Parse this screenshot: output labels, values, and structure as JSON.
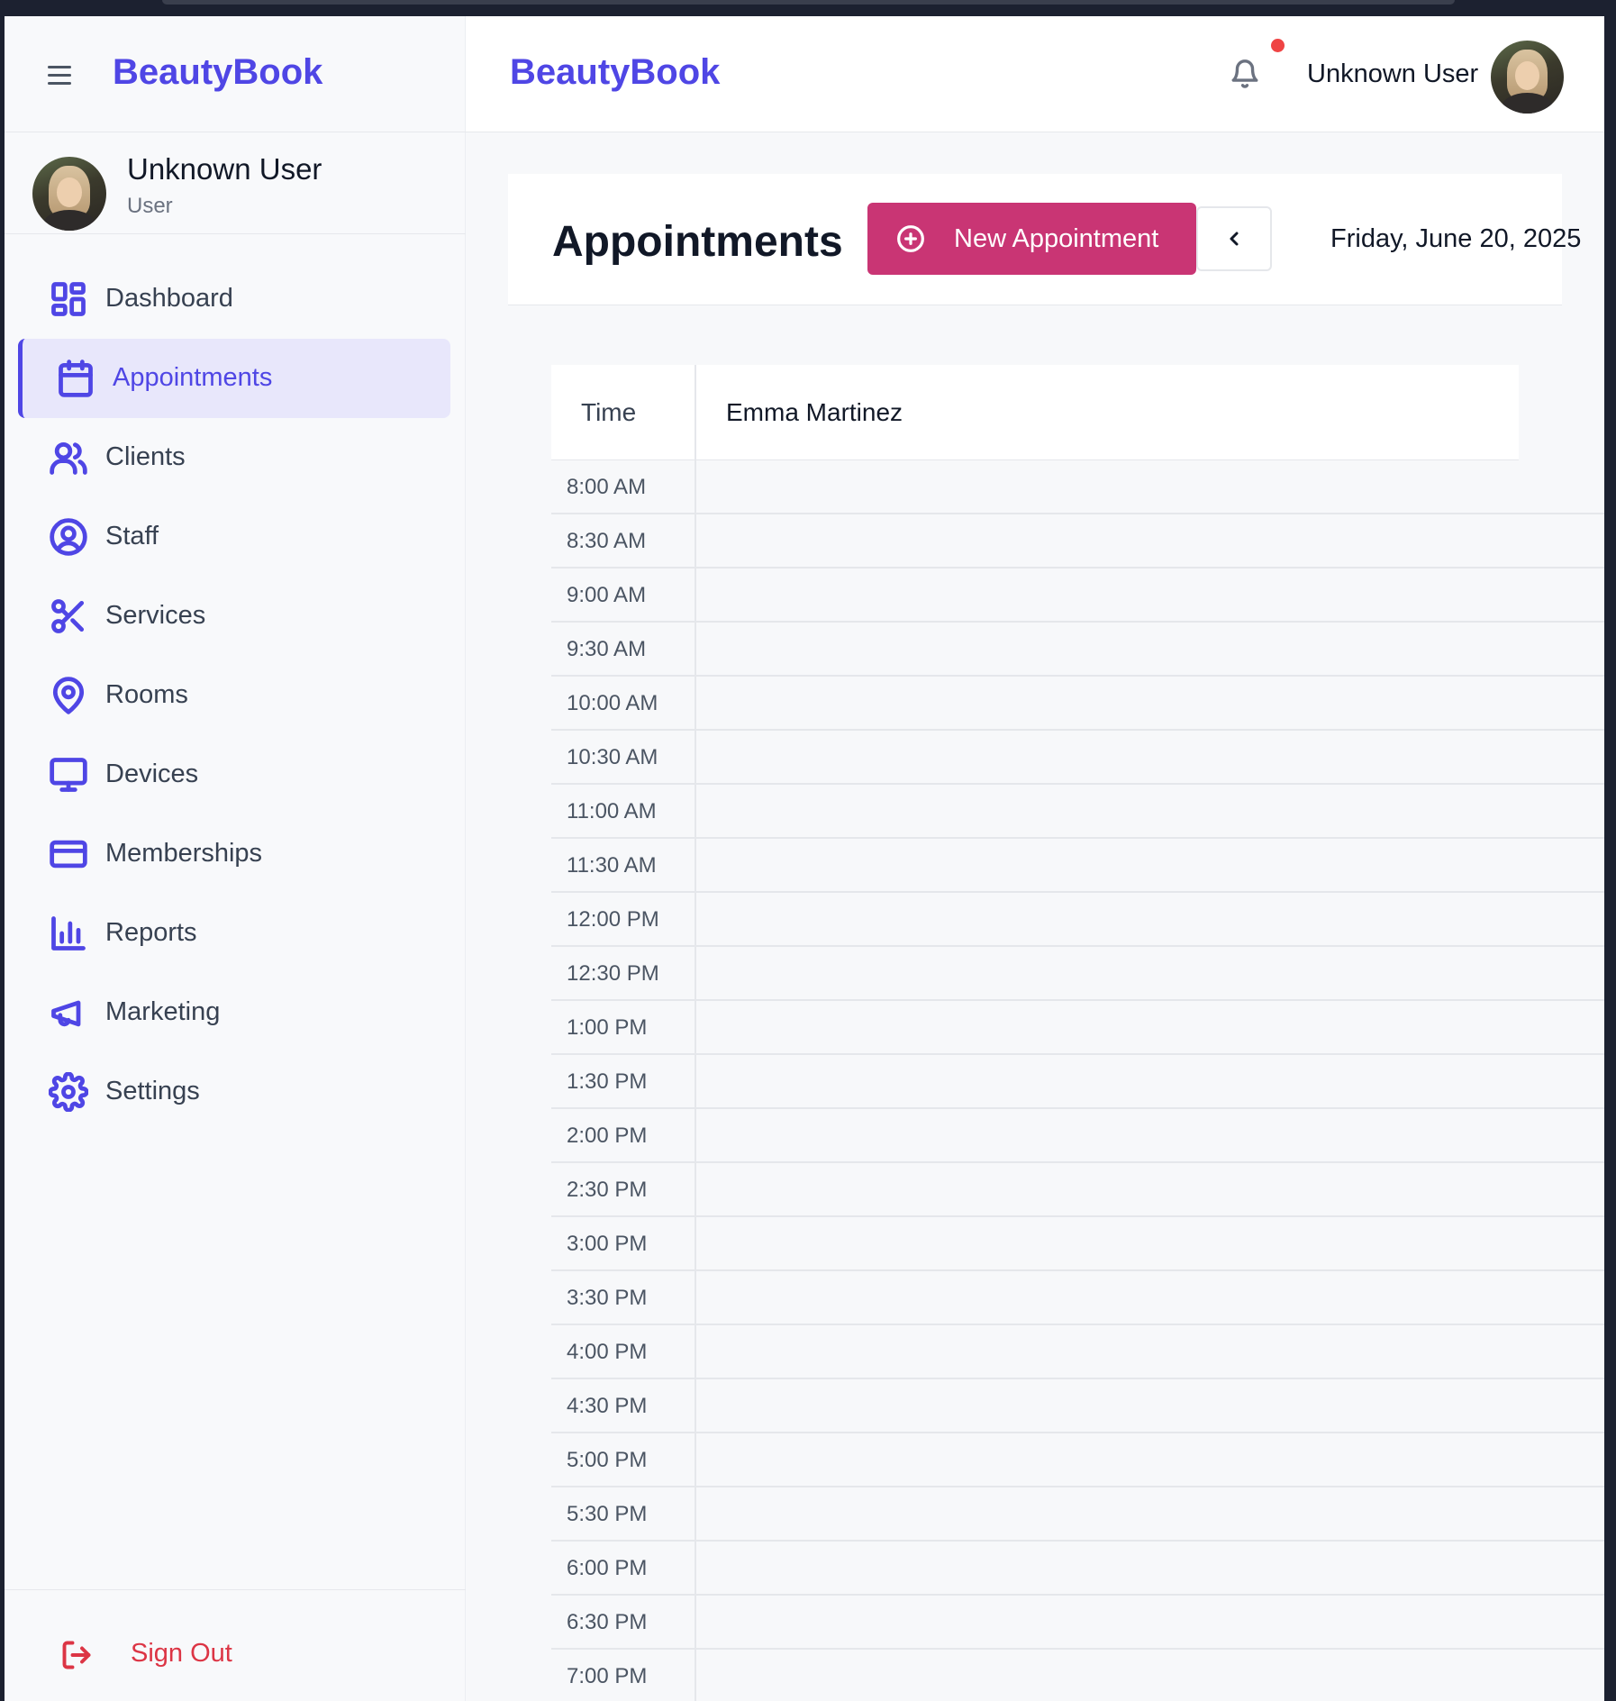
{
  "app": {
    "brand": "BeautyBook"
  },
  "sidebar": {
    "user": {
      "name": "Unknown User",
      "role": "User"
    },
    "items": [
      {
        "label": "Dashboard",
        "icon": "dashboard-icon"
      },
      {
        "label": "Appointments",
        "icon": "calendar-icon",
        "active": true
      },
      {
        "label": "Clients",
        "icon": "users-icon"
      },
      {
        "label": "Staff",
        "icon": "user-circle-icon"
      },
      {
        "label": "Services",
        "icon": "scissors-icon"
      },
      {
        "label": "Rooms",
        "icon": "map-pin-icon"
      },
      {
        "label": "Devices",
        "icon": "monitor-icon"
      },
      {
        "label": "Memberships",
        "icon": "credit-card-icon"
      },
      {
        "label": "Reports",
        "icon": "bar-chart-icon"
      },
      {
        "label": "Marketing",
        "icon": "megaphone-icon"
      },
      {
        "label": "Settings",
        "icon": "gear-icon"
      }
    ],
    "sign_out": "Sign Out"
  },
  "header": {
    "user_name": "Unknown User",
    "has_notification": true
  },
  "page": {
    "title": "Appointments",
    "new_button": "New Appointment",
    "date": "Friday, June 20, 2025"
  },
  "schedule": {
    "time_header": "Time",
    "staff": [
      "Emma Martinez"
    ],
    "times": [
      "8:00 AM",
      "8:30 AM",
      "9:00 AM",
      "9:30 AM",
      "10:00 AM",
      "10:30 AM",
      "11:00 AM",
      "11:30 AM",
      "12:00 PM",
      "12:30 PM",
      "1:00 PM",
      "1:30 PM",
      "2:00 PM",
      "2:30 PM",
      "3:00 PM",
      "3:30 PM",
      "4:00 PM",
      "4:30 PM",
      "5:00 PM",
      "5:30 PM",
      "6:00 PM",
      "6:30 PM",
      "7:00 PM"
    ]
  },
  "colors": {
    "brand": "#4f46e5",
    "accent_button": "#c93574",
    "sign_out": "#dc3545",
    "notification_dot": "#ef4444"
  }
}
